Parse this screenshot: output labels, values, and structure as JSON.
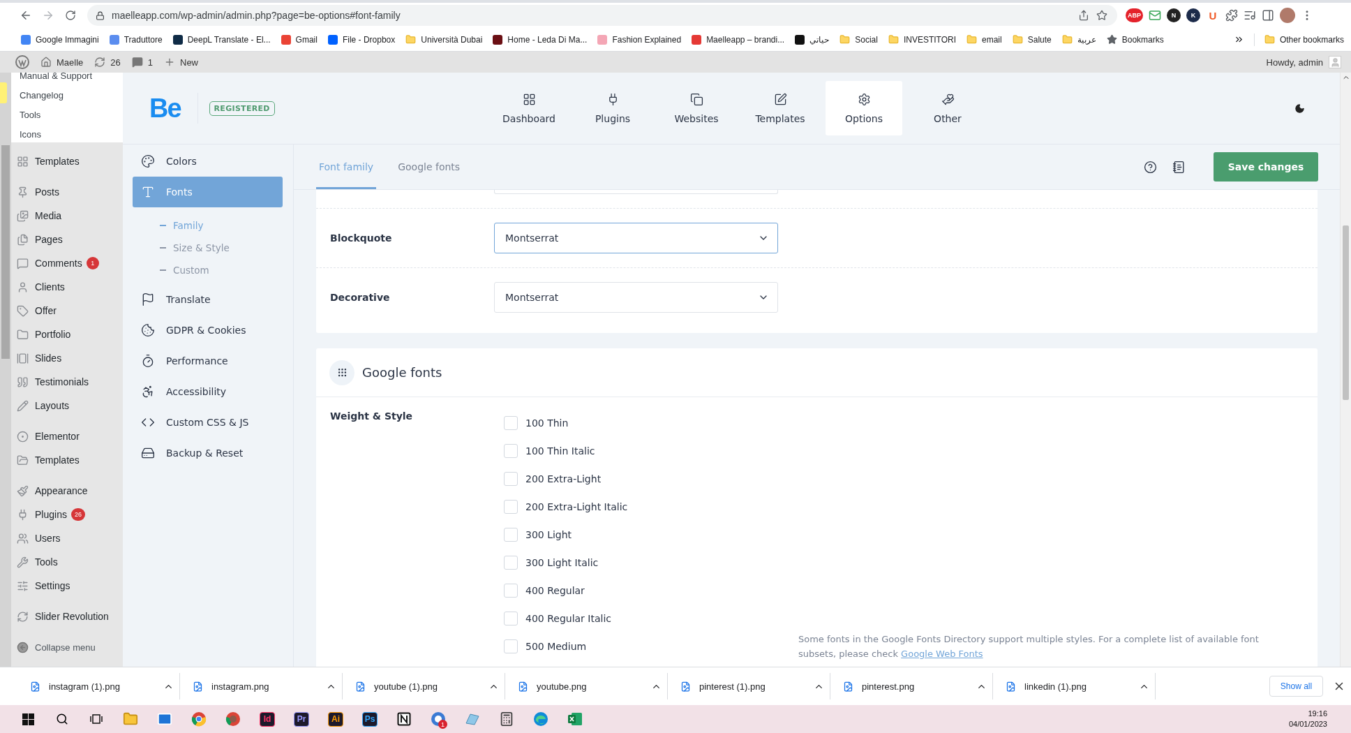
{
  "browser": {
    "url": "maelleapp.com/wp-admin/admin.php?page=be-options#font-family",
    "extensions": [
      {
        "kind": "badge",
        "label": "ABP"
      },
      {
        "kind": "mail"
      },
      {
        "kind": "badge",
        "label": "N"
      },
      {
        "kind": "badge",
        "label": "K"
      },
      {
        "kind": "badge",
        "label": "U"
      }
    ],
    "bookmarks": [
      {
        "kind": "site",
        "label": "Google Immagini",
        "color": "#4285f4"
      },
      {
        "kind": "site",
        "label": "Traduttore",
        "color": "#5b8def"
      },
      {
        "kind": "site",
        "label": "DeepL Translate - El...",
        "color": "#0f2b46"
      },
      {
        "kind": "site",
        "label": "Gmail",
        "color": "#ea4335"
      },
      {
        "kind": "site",
        "label": "File - Dropbox",
        "color": "#0061ff"
      },
      {
        "kind": "folder",
        "label": "Università Dubai"
      },
      {
        "kind": "site",
        "label": "Home - Leda Di Ma...",
        "color": "#6b0f14"
      },
      {
        "kind": "site",
        "label": "Fashion Explained",
        "color": "#f4a6b5"
      },
      {
        "kind": "site",
        "label": "Maelleapp – brandi...",
        "color": "#e53935"
      },
      {
        "kind": "site",
        "label": "حياتي",
        "color": "#111111"
      },
      {
        "kind": "folder",
        "label": "Social"
      },
      {
        "kind": "folder",
        "label": "INVESTITORI"
      },
      {
        "kind": "folder",
        "label": "email"
      },
      {
        "kind": "folder",
        "label": "Salute"
      },
      {
        "kind": "folder",
        "label": "عربية"
      },
      {
        "kind": "star",
        "label": "Bookmarks"
      }
    ],
    "other_bookmarks": "Other bookmarks"
  },
  "admin_bar": {
    "site": "Maelle",
    "updates": "26",
    "comments": "1",
    "new": "New",
    "greeting": "Howdy, admin"
  },
  "wp_menu": {
    "submenu": [
      {
        "label": "Manual & Support"
      },
      {
        "label": "Changelog"
      },
      {
        "label": "Tools"
      },
      {
        "label": "Icons"
      }
    ],
    "groups": [
      {
        "items": [
          {
            "label": "Templates"
          }
        ]
      },
      {
        "items": [
          {
            "label": "Posts"
          },
          {
            "label": "Media"
          },
          {
            "label": "Pages"
          },
          {
            "label": "Comments",
            "badge": "1"
          },
          {
            "label": "Clients"
          },
          {
            "label": "Offer"
          },
          {
            "label": "Portfolio"
          },
          {
            "label": "Slides"
          },
          {
            "label": "Testimonials"
          },
          {
            "label": "Layouts"
          }
        ]
      },
      {
        "items": [
          {
            "label": "Elementor"
          },
          {
            "label": "Templates"
          }
        ]
      },
      {
        "items": [
          {
            "label": "Appearance"
          },
          {
            "label": "Plugins",
            "badge": "26"
          },
          {
            "label": "Users"
          },
          {
            "label": "Tools"
          },
          {
            "label": "Settings"
          }
        ]
      },
      {
        "items": [
          {
            "label": "Slider Revolution"
          }
        ]
      }
    ],
    "collapse": "Collapse menu"
  },
  "be": {
    "logo": "Be",
    "status": "REGISTERED",
    "tabs": [
      {
        "label": "Dashboard",
        "selected": false
      },
      {
        "label": "Plugins",
        "selected": false
      },
      {
        "label": "Websites",
        "selected": false
      },
      {
        "label": "Templates",
        "selected": false
      },
      {
        "label": "Options",
        "selected": true
      },
      {
        "label": "Other",
        "selected": false
      }
    ],
    "sidebar": [
      {
        "label": "Colors",
        "selected": false
      },
      {
        "label": "Fonts",
        "selected": true,
        "children": [
          {
            "label": "Family",
            "selected": true
          },
          {
            "label": "Size & Style",
            "selected": false
          },
          {
            "label": "Custom",
            "selected": false
          }
        ]
      },
      {
        "label": "Translate",
        "selected": false
      },
      {
        "label": "GDPR & Cookies",
        "selected": false
      },
      {
        "label": "Performance",
        "selected": false
      },
      {
        "label": "Accessibility",
        "selected": false
      },
      {
        "label": "Custom CSS & JS",
        "selected": false
      },
      {
        "label": "Backup & Reset",
        "selected": false
      }
    ],
    "subtabs": [
      {
        "label": "Font family",
        "selected": true
      },
      {
        "label": "Google fonts",
        "selected": false
      }
    ],
    "save": "Save changes"
  },
  "fonts_card": {
    "rows": [
      {
        "label": "Blockquote",
        "value": "Montserrat",
        "focused": true
      },
      {
        "label": "Decorative",
        "value": "Montserrat",
        "focused": false
      }
    ]
  },
  "google_fonts": {
    "title": "Google fonts",
    "field_label": "Weight & Style",
    "options": [
      {
        "label": "100 Thin",
        "checked": false
      },
      {
        "label": "100 Thin Italic",
        "checked": false
      },
      {
        "label": "200 Extra-Light",
        "checked": false
      },
      {
        "label": "200 Extra-Light Italic",
        "checked": false
      },
      {
        "label": "300 Light",
        "checked": false
      },
      {
        "label": "300 Light Italic",
        "checked": false
      },
      {
        "label": "400 Regular",
        "checked": false
      },
      {
        "label": "400 Regular Italic",
        "checked": false
      },
      {
        "label": "500 Medium",
        "checked": false
      }
    ],
    "note": {
      "text": "Some fonts in the Google Fonts Directory support multiple styles. For a complete list of available font subsets, please check",
      "link": "Google Web Fonts"
    }
  },
  "downloads": {
    "items": [
      {
        "name": "instagram (1).png"
      },
      {
        "name": "instagram.png"
      },
      {
        "name": "youtube (1).png"
      },
      {
        "name": "youtube.png"
      },
      {
        "name": "pinterest (1).png"
      },
      {
        "name": "pinterest.png"
      },
      {
        "name": "linkedin (1).png"
      }
    ],
    "show_all": "Show all"
  },
  "taskbar": {
    "apps": [
      {
        "label": "Id",
        "color": "#ff3366"
      },
      {
        "label": "Pr",
        "color": "#9999ff"
      },
      {
        "label": "Ai",
        "color": "#ff9a00"
      },
      {
        "label": "Ps",
        "color": "#31a8ff"
      }
    ],
    "mail_badge": "1",
    "time": "19:16",
    "date": "04/01/2023"
  }
}
